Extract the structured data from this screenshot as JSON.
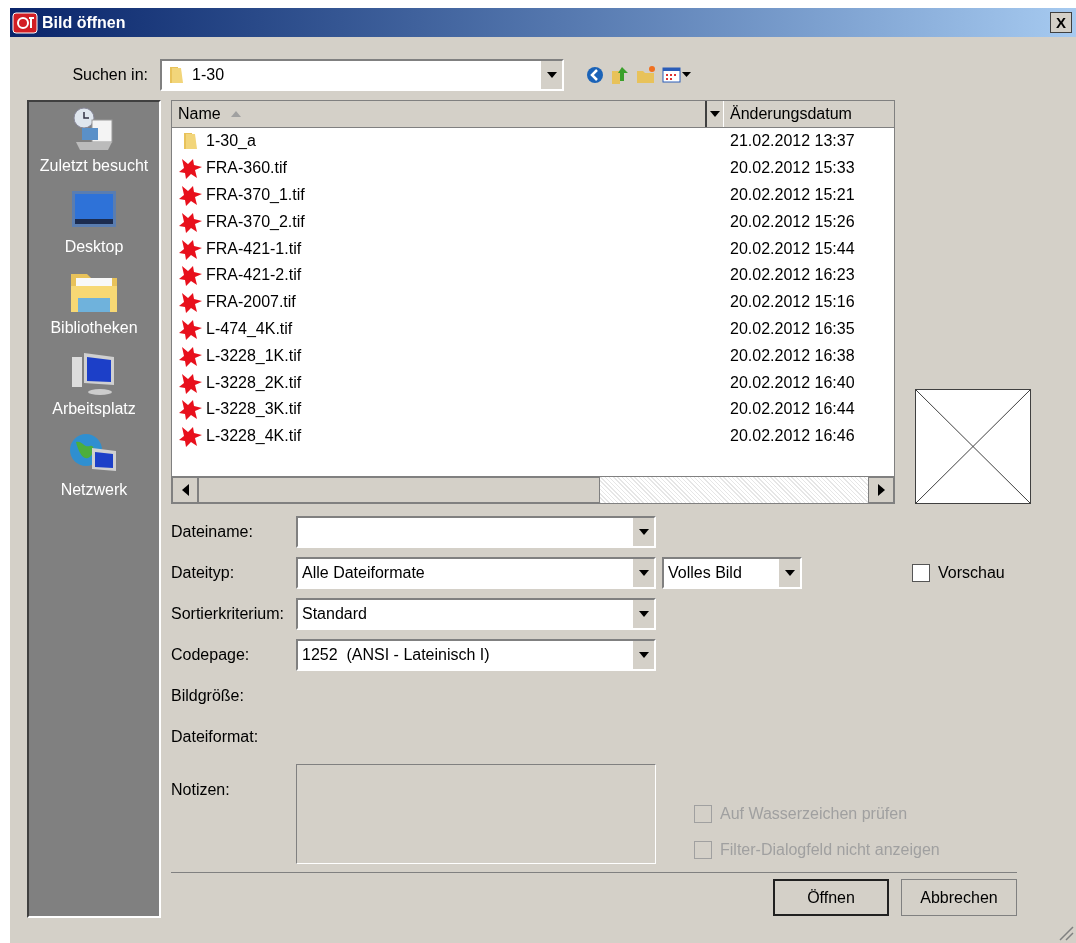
{
  "window": {
    "title": "Bild öffnen",
    "close": "X"
  },
  "look_in": {
    "label": "Suchen in:",
    "value": "1-30"
  },
  "places": [
    {
      "label": "Zuletzt besucht",
      "kind": "recent"
    },
    {
      "label": "Desktop",
      "kind": "desktop"
    },
    {
      "label": "Bibliotheken",
      "kind": "libraries"
    },
    {
      "label": "Arbeitsplatz",
      "kind": "computer"
    },
    {
      "label": "Netzwerk",
      "kind": "network"
    }
  ],
  "file_list": {
    "columns": [
      "Name",
      "Änderungsdatum"
    ],
    "rows": [
      {
        "kind": "folder",
        "name": "1-30_a",
        "date": "21.02.2012 13:37"
      },
      {
        "kind": "tif",
        "name": "FRA-360.tif",
        "date": "20.02.2012 15:33"
      },
      {
        "kind": "tif",
        "name": "FRA-370_1.tif",
        "date": "20.02.2012 15:21"
      },
      {
        "kind": "tif",
        "name": "FRA-370_2.tif",
        "date": "20.02.2012 15:26"
      },
      {
        "kind": "tif",
        "name": "FRA-421-1.tif",
        "date": "20.02.2012 15:44"
      },
      {
        "kind": "tif",
        "name": "FRA-421-2.tif",
        "date": "20.02.2012 16:23"
      },
      {
        "kind": "tif",
        "name": "FRA-2007.tif",
        "date": "20.02.2012 15:16"
      },
      {
        "kind": "tif",
        "name": "L-474_4K.tif",
        "date": "20.02.2012 16:35"
      },
      {
        "kind": "tif",
        "name": "L-3228_1K.tif",
        "date": "20.02.2012 16:38"
      },
      {
        "kind": "tif",
        "name": "L-3228_2K.tif",
        "date": "20.02.2012 16:40"
      },
      {
        "kind": "tif",
        "name": "L-3228_3K.tif",
        "date": "20.02.2012 16:44"
      },
      {
        "kind": "tif",
        "name": "L-3228_4K.tif",
        "date": "20.02.2012 16:46"
      }
    ]
  },
  "fields": [
    {
      "label": "Dateiname:"
    },
    {
      "label": "Dateityp:",
      "value": "Alle Dateiformate",
      "extra": "Volles Bild"
    },
    {
      "label": "Sortierkriterium:",
      "value": "Standard"
    },
    {
      "label": "Codepage:",
      "value": "1252  (ANSI - Lateinisch I)"
    }
  ],
  "info": [
    "Bildgröße:",
    "Dateiformat:"
  ],
  "notes": {
    "label": "Notizen:"
  },
  "preview": {
    "label": "Vorschau",
    "checked": false
  },
  "options": [
    {
      "label": "Auf Wasserzeichen prüfen",
      "checked": false,
      "disabled": true
    },
    {
      "label": "Filter-Dialogfeld nicht anzeigen",
      "checked": false,
      "disabled": true
    }
  ],
  "buttons": [
    "Öffnen",
    "Abbrechen"
  ]
}
